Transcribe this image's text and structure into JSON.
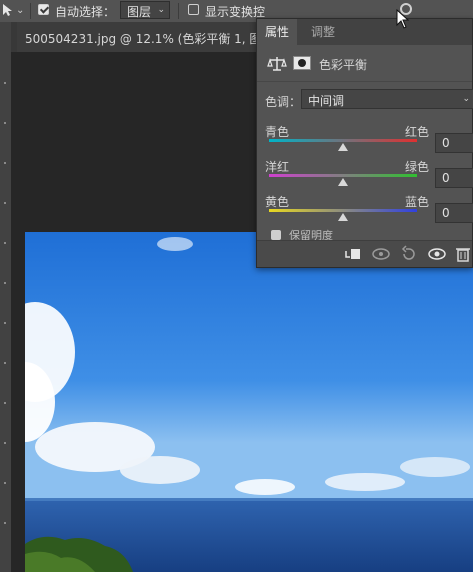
{
  "options_bar": {
    "auto_select_label": "自动选择：",
    "auto_select_checked": true,
    "auto_select_target": "图层",
    "show_transform_label": "显示变换控",
    "show_transform_checked": false
  },
  "document": {
    "tab_title": "500504231.jpg @ 12.1% (色彩平衡 1, 图层蒙"
  },
  "properties_panel": {
    "tabs": [
      {
        "label": "属性",
        "active": true
      },
      {
        "label": "调整",
        "active": false
      }
    ],
    "adjustment_title": "色彩平衡",
    "tone_label": "色调：",
    "tone_value": "中间调",
    "sliders": [
      {
        "left_label": "青色",
        "right_label": "红色",
        "value": "0",
        "colors": [
          "#00b4c8",
          "#e03030"
        ]
      },
      {
        "left_label": "洋红",
        "right_label": "绿色",
        "value": "0",
        "colors": [
          "#d040d0",
          "#30c030"
        ]
      },
      {
        "left_label": "黄色",
        "right_label": "蓝色",
        "value": "0",
        "colors": [
          "#e8d820",
          "#3040e0"
        ]
      }
    ],
    "preserve_luminosity_label": "保留明度",
    "preserve_luminosity_checked": true
  },
  "colors": {
    "app_bg": "#252525",
    "panel_bg": "#535353",
    "sky_top": "#1f6fd6",
    "sea": "#1c4d95"
  }
}
